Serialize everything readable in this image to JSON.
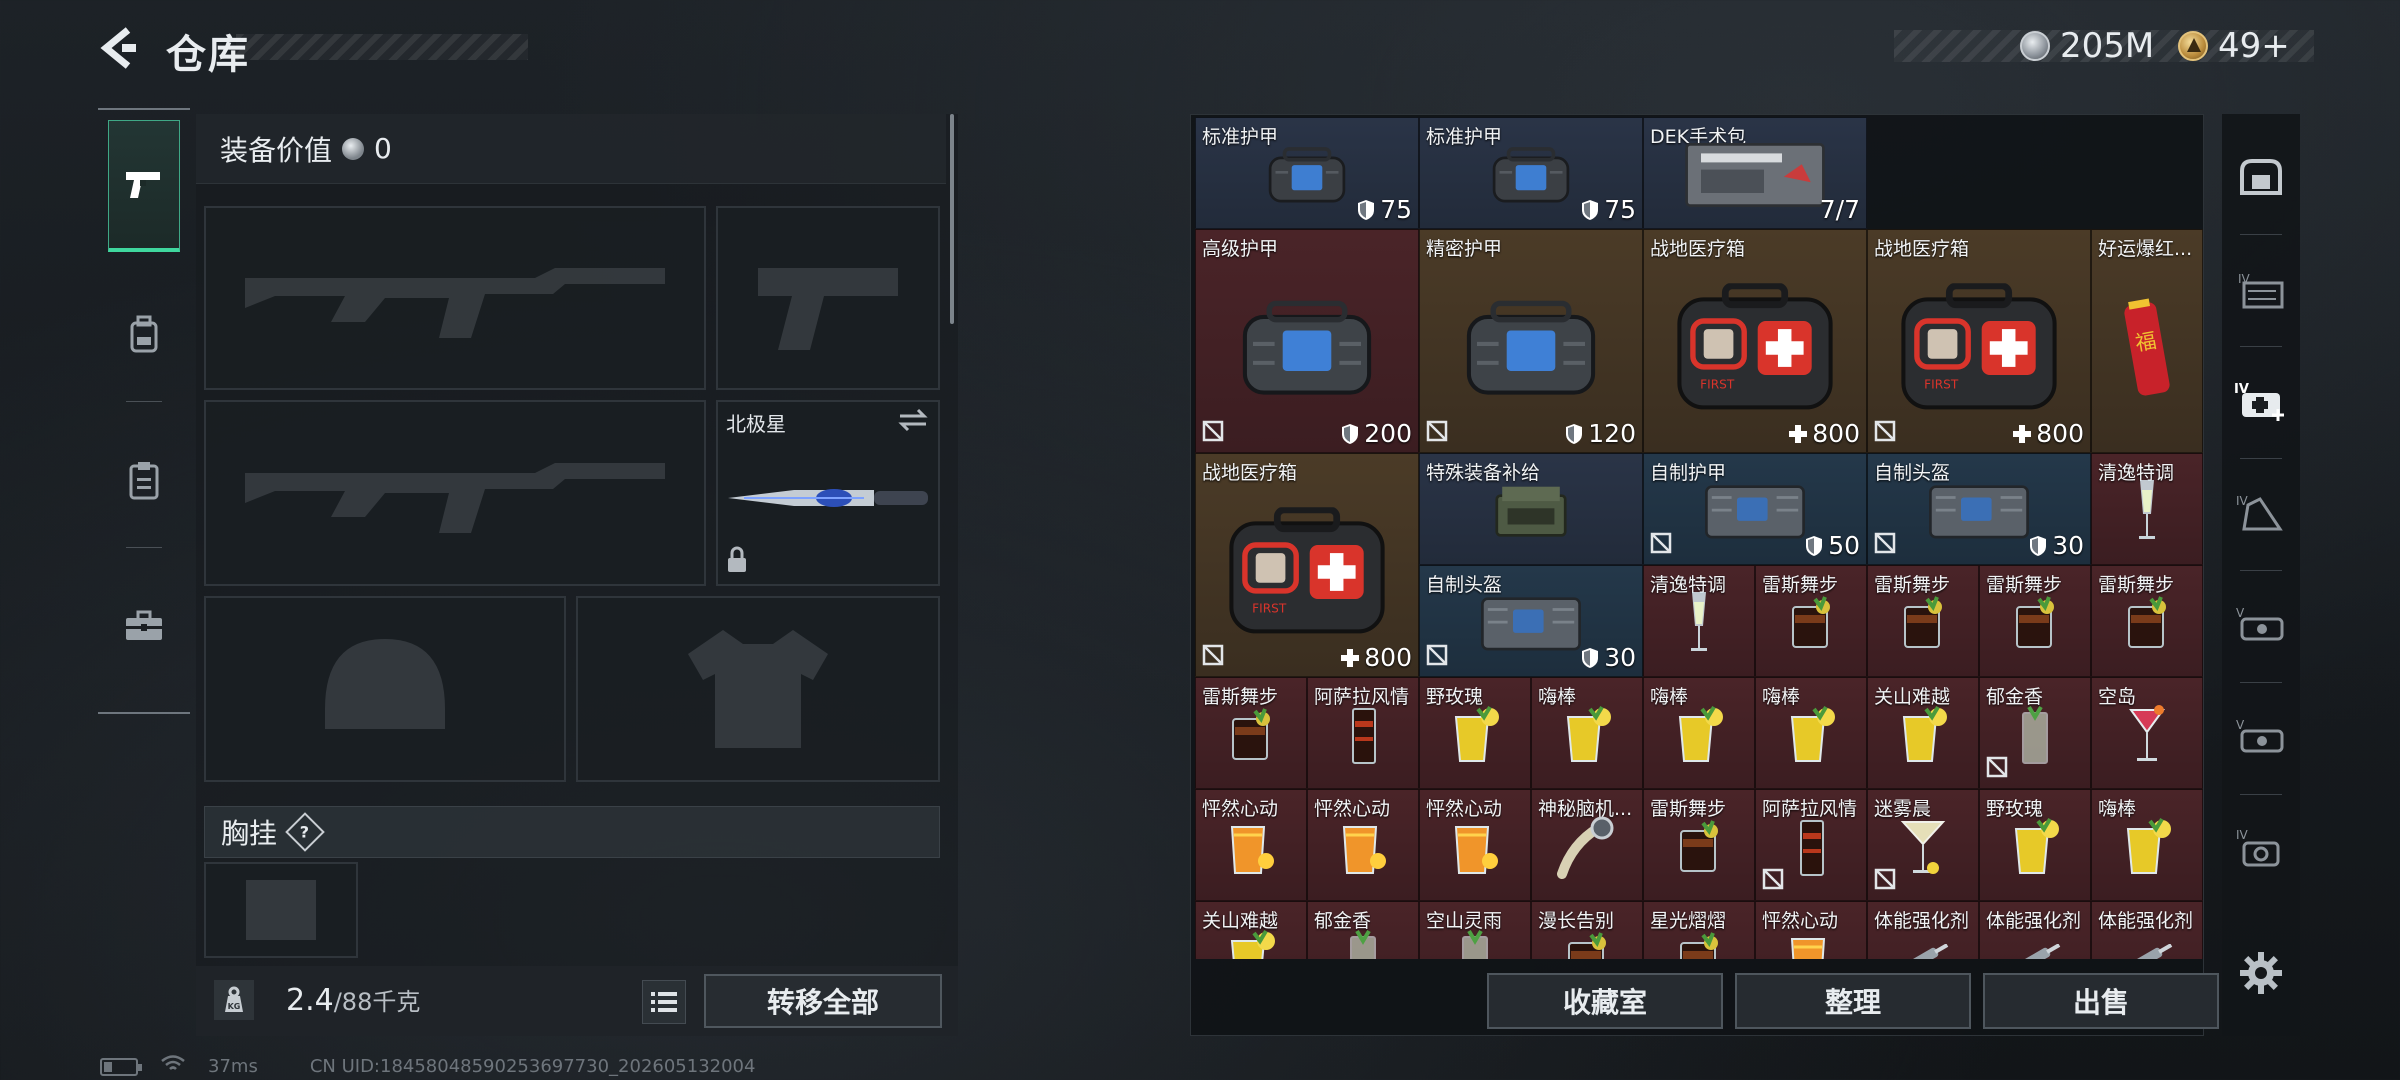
{
  "header": {
    "title": "仓库",
    "currencies": [
      {
        "icon": "silver-coin-icon",
        "value": "205M"
      },
      {
        "icon": "gold-token-icon",
        "value": "49+"
      }
    ]
  },
  "left_nav": {
    "items": [
      {
        "icon": "pistol-icon",
        "active": true
      },
      {
        "icon": "backpack-icon",
        "active": false
      },
      {
        "icon": "clipboard-icon",
        "active": false
      },
      {
        "icon": "briefcase-icon",
        "active": false
      }
    ]
  },
  "loadout": {
    "value_label": "装备价值",
    "value": "0",
    "melee_slot_name": "北极星",
    "chest_rig_label": "胸挂",
    "chest_rig_help": "?",
    "weight_current": "2.4",
    "weight_capacity": "/88千克",
    "weight_icon_text": "KG",
    "transfer_all_label": "转移全部"
  },
  "storage": {
    "items": [
      {
        "name": "标准护甲",
        "stat": "75",
        "stat_icon": "shield",
        "color": "blue",
        "art": "bag"
      },
      {
        "name": "标准护甲",
        "stat": "75",
        "stat_icon": "shield",
        "color": "blue",
        "art": "bag"
      },
      {
        "name": "DEK手术包",
        "stat": "7/7",
        "stat_icon": "",
        "color": "blue",
        "art": "kit"
      },
      {
        "name": "高级护甲",
        "stat": "200",
        "stat_icon": "shield",
        "color": "red",
        "art": "bagbig",
        "noins": true
      },
      {
        "name": "精密护甲",
        "stat": "120",
        "stat_icon": "shield",
        "color": "gold",
        "art": "bagbig",
        "noins": true
      },
      {
        "name": "战地医疗箱",
        "stat": "800",
        "stat_icon": "plus",
        "color": "gold",
        "art": "medkit"
      },
      {
        "name": "战地医疗箱",
        "stat": "800",
        "stat_icon": "plus",
        "color": "gold",
        "art": "medkit",
        "noins": true
      },
      {
        "name": "好运爆红...",
        "stat": "",
        "stat_icon": "",
        "color": "gold",
        "art": "firecracker"
      },
      {
        "name": "战地医疗箱",
        "stat": "800",
        "stat_icon": "plus",
        "color": "gold",
        "art": "medkit",
        "noins": true
      },
      {
        "name": "特殊装备补给",
        "stat": "",
        "stat_icon": "",
        "color": "blue",
        "art": "crate"
      },
      {
        "name": "自制护甲",
        "stat": "50",
        "stat_icon": "shield",
        "color": "teal",
        "art": "vest",
        "noins": true
      },
      {
        "name": "自制头盔",
        "stat": "30",
        "stat_icon": "shield",
        "color": "teal",
        "art": "vest",
        "noins": true
      },
      {
        "name": "清逸特调",
        "stat": "",
        "stat_icon": "",
        "color": "red",
        "art": "flute"
      },
      {
        "name": "自制头盔",
        "stat": "30",
        "stat_icon": "shield",
        "color": "teal",
        "art": "vest",
        "noins": true
      },
      {
        "name": "清逸特调",
        "stat": "",
        "stat_icon": "",
        "color": "red",
        "art": "flute"
      },
      {
        "name": "雷斯舞步",
        "stat": "",
        "stat_icon": "",
        "color": "red",
        "art": "cola"
      },
      {
        "name": "雷斯舞步",
        "stat": "",
        "stat_icon": "",
        "color": "red",
        "art": "cola"
      },
      {
        "name": "雷斯舞步",
        "stat": "",
        "stat_icon": "",
        "color": "red",
        "art": "cola"
      },
      {
        "name": "雷斯舞步",
        "stat": "",
        "stat_icon": "",
        "color": "red",
        "art": "cola"
      },
      {
        "name": "雷斯舞步",
        "stat": "",
        "stat_icon": "",
        "color": "red",
        "art": "cola"
      },
      {
        "name": "阿萨拉风情",
        "stat": "",
        "stat_icon": "",
        "color": "red",
        "art": "tall"
      },
      {
        "name": "野玫瑰",
        "stat": "",
        "stat_icon": "",
        "color": "red",
        "art": "lemon"
      },
      {
        "name": "嗨棒",
        "stat": "",
        "stat_icon": "",
        "color": "red",
        "art": "lemon"
      },
      {
        "name": "嗨棒",
        "stat": "",
        "stat_icon": "",
        "color": "red",
        "art": "lemon"
      },
      {
        "name": "嗨棒",
        "stat": "",
        "stat_icon": "",
        "color": "red",
        "art": "lemon"
      },
      {
        "name": "关山难越",
        "stat": "",
        "stat_icon": "",
        "color": "red",
        "art": "lemon"
      },
      {
        "name": "郁金香",
        "stat": "",
        "stat_icon": "",
        "color": "red",
        "art": "clear",
        "noins": true
      },
      {
        "name": "空岛",
        "stat": "",
        "stat_icon": "",
        "color": "red",
        "art": "pink"
      },
      {
        "name": "怦然心动",
        "stat": "",
        "stat_icon": "",
        "color": "red",
        "art": "orange"
      },
      {
        "name": "怦然心动",
        "stat": "",
        "stat_icon": "",
        "color": "red",
        "art": "orange"
      },
      {
        "name": "怦然心动",
        "stat": "",
        "stat_icon": "",
        "color": "red",
        "art": "orange"
      },
      {
        "name": "神秘脑机...",
        "stat": "",
        "stat_icon": "",
        "color": "red",
        "art": "device"
      },
      {
        "name": "雷斯舞步",
        "stat": "",
        "stat_icon": "",
        "color": "red",
        "art": "cola"
      },
      {
        "name": "阿萨拉风情",
        "stat": "",
        "stat_icon": "",
        "color": "red",
        "art": "tall",
        "noins": true
      },
      {
        "name": "迷雾晨",
        "stat": "",
        "stat_icon": "",
        "color": "red",
        "art": "martini",
        "noins": true
      },
      {
        "name": "野玫瑰",
        "stat": "",
        "stat_icon": "",
        "color": "red",
        "art": "lemon"
      },
      {
        "name": "嗨棒",
        "stat": "",
        "stat_icon": "",
        "color": "red",
        "art": "lemon"
      },
      {
        "name": "关山难越",
        "stat": "",
        "stat_icon": "",
        "color": "red",
        "art": "lemon"
      },
      {
        "name": "郁金香",
        "stat": "",
        "stat_icon": "",
        "color": "red",
        "art": "clear"
      },
      {
        "name": "空山灵雨",
        "stat": "",
        "stat_icon": "",
        "color": "red",
        "art": "clear"
      },
      {
        "name": "漫长告别",
        "stat": "",
        "stat_icon": "",
        "color": "red",
        "art": "cola"
      },
      {
        "name": "星光熠熠",
        "stat": "",
        "stat_icon": "",
        "color": "red",
        "art": "cola"
      },
      {
        "name": "怦然心动",
        "stat": "",
        "stat_icon": "",
        "color": "red",
        "art": "orange"
      },
      {
        "name": "体能强化剂",
        "stat": "",
        "stat_icon": "",
        "color": "red",
        "art": "syringe"
      },
      {
        "name": "体能强化剂",
        "stat": "",
        "stat_icon": "",
        "color": "red",
        "art": "syringe"
      },
      {
        "name": "体能强化剂",
        "stat": "",
        "stat_icon": "",
        "color": "red",
        "art": "syringe"
      }
    ],
    "actions": [
      "收藏室",
      "整理",
      "出售"
    ]
  },
  "right_rail": {
    "items": [
      "safe-box-icon",
      "iv-folder-icon",
      "iv-medkit-icon",
      "iv-armor-icon",
      "v-vehicle-icon",
      "v-vehicle-2-icon",
      "iv-gear-icon"
    ]
  },
  "status": {
    "ping": "37ms",
    "uid": "CN UID:18458048590253697730_202605132004"
  },
  "colors": {
    "accent_green": "#3fd79e",
    "cell_blue": "#2a3447",
    "cell_red": "#4a2428",
    "cell_gold": "#4b3b27"
  }
}
